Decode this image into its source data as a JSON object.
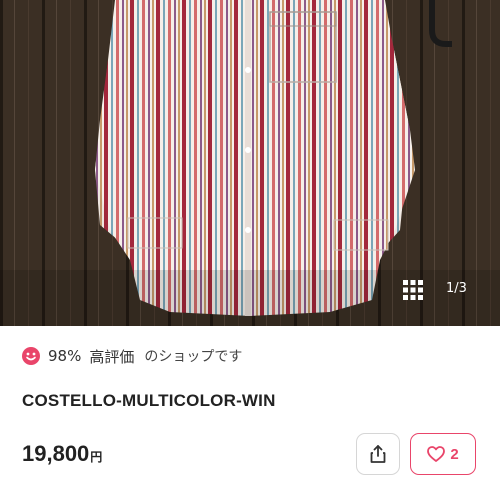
{
  "gallery": {
    "counter": "1/3",
    "image_alt": "multicolor striped shirt on wooden wall",
    "grid_icon": "grid-icon"
  },
  "shop": {
    "rating_percent": "98%",
    "rating_label": "高評価",
    "rating_suffix": "のショップです",
    "icon": "smile-icon",
    "accent_color": "#e9456a"
  },
  "product": {
    "title": "COSTELLO-MULTICOLOR-WIN",
    "price": "19,800",
    "currency": "円"
  },
  "actions": {
    "share_icon": "share-icon",
    "like_icon": "heart-icon",
    "like_count": "2"
  }
}
